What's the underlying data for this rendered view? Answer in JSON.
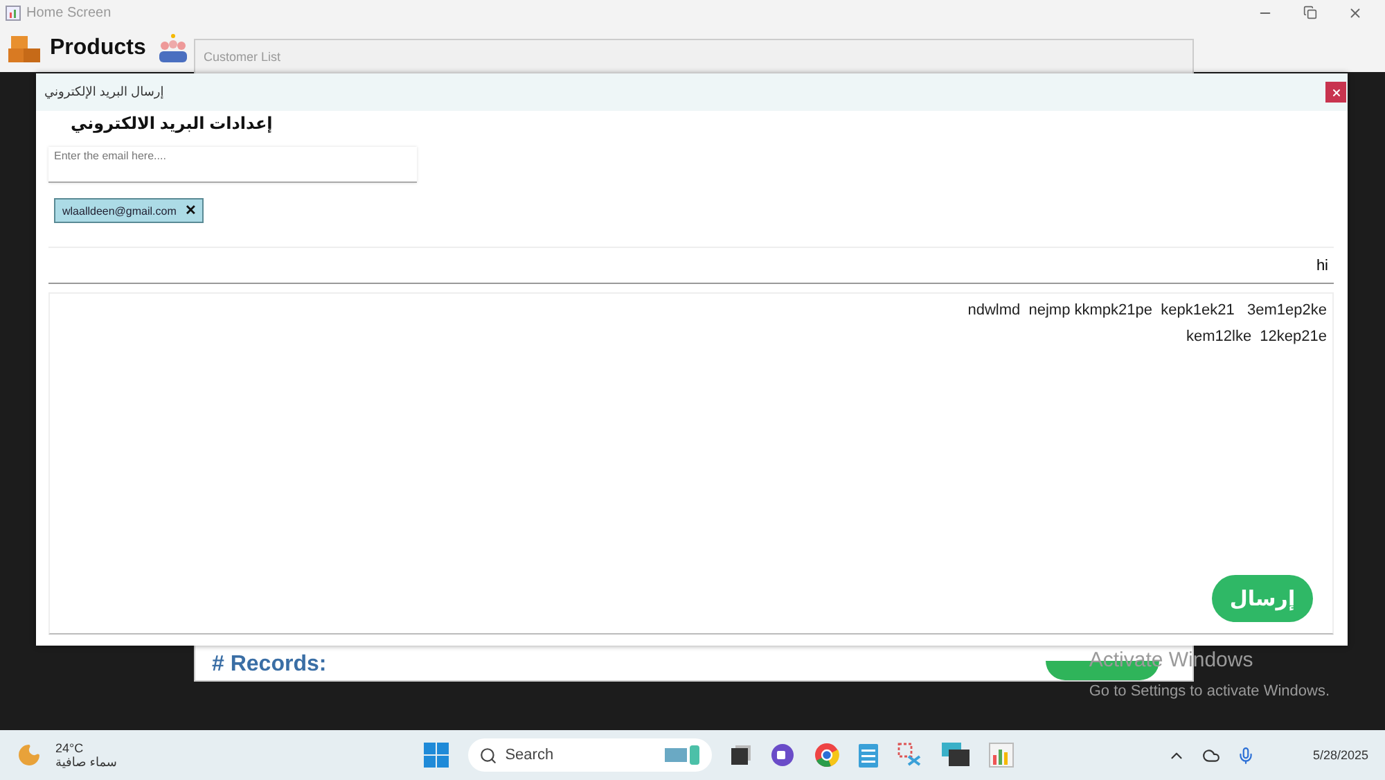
{
  "app_window": {
    "title": "Home Screen",
    "header_label": "Products"
  },
  "background_window": {
    "title": "Customer List",
    "records_label": "# Records:"
  },
  "dialog": {
    "title": "إرسال البريد الإلكتروني",
    "heading": "إعدادات البريد الالكتروني",
    "email_field": {
      "placeholder": "Enter the email here...."
    },
    "recipients": [
      {
        "email": "wlaalldeen@gmail.com",
        "remove": "✕"
      }
    ],
    "subject": "hi",
    "body_lines": [
      "ndwlmd  nejmp kkmpk21pe  kepk1ek21   3em1ep2ke",
      "kem12lke  12kep21e"
    ],
    "send_button": "إرسال"
  },
  "activation_notice": {
    "title": "Activate Windows",
    "subtitle": "Go to Settings to activate Windows."
  },
  "taskbar": {
    "temperature": "24°C",
    "weather": "سماء صافية",
    "search_placeholder": "Search",
    "date": "5/28/2025"
  }
}
